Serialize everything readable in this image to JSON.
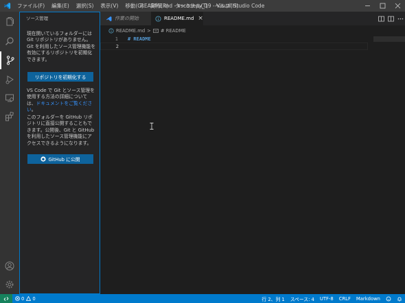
{
  "titlebar": {
    "menu": [
      "ファイル(F)",
      "編集(E)",
      "選択(S)",
      "表示(V)",
      "移動(G)",
      "実行(R)",
      "ターミナル(T)",
      "ヘルプ(H)"
    ],
    "window_title": "README.md - vscodepy_19 - Visual Studio Code"
  },
  "sidebar": {
    "title": "ソース管理",
    "para1": "現在開いているフォルダーには Git リポジトリがありません。Git を利用したソース管理機能を有効にするリポジトリを初期化できます。",
    "init_button": "リポジトリを初期化する",
    "para2_prefix": "VS Code で Git とソース管理を使用する方法の詳細については、",
    "para2_link": "ドキュメントをご覧ください",
    "para2_suffix": "。",
    "para3": "このフォルダーを GitHub リポジトリに直接公開することもできます。公開後、Git と GitHub を利用したソース管理機能にアクセスできるようになります。",
    "publish_button": "GitHub に公開"
  },
  "tabs": {
    "welcome": "作業の開始",
    "readme": "README.md",
    "close": "×"
  },
  "breadcrumb": {
    "file": "README.md",
    "separator": ">",
    "symbol": "# README"
  },
  "editor": {
    "lines": [
      {
        "number": "1",
        "text": "# README"
      },
      {
        "number": "2",
        "text": ""
      }
    ]
  },
  "statusbar": {
    "errors": "0",
    "warnings": "0",
    "position": "行 2、列 1",
    "spaces": "スペース: 4",
    "encoding": "UTF-8",
    "eol": "CRLF",
    "language": "Markdown"
  },
  "colors": {
    "accent": "#007acc",
    "button": "#0e639c",
    "link": "#3794ff",
    "remote": "#16825d"
  }
}
